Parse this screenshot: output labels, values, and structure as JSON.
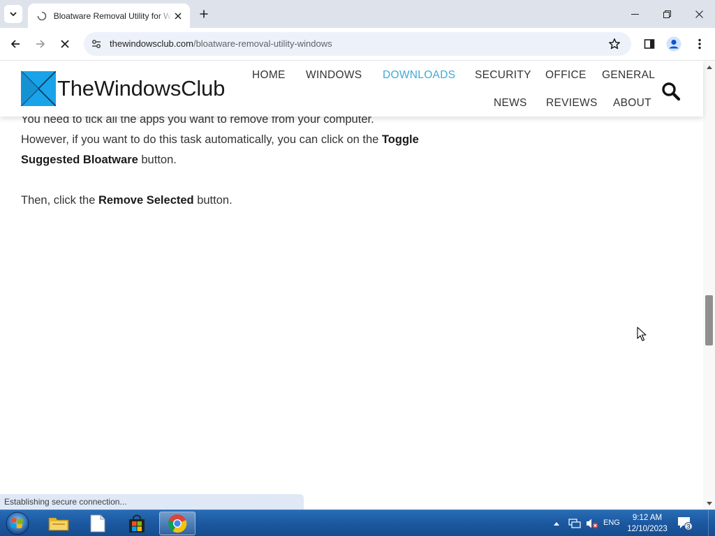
{
  "browser": {
    "tab": {
      "title": "Bloatware Removal Utility for Windows"
    },
    "url": {
      "host": "thewindowsclub.com",
      "path": "/bloatware-removal-utility-windows"
    },
    "status_text": "Establishing secure connection..."
  },
  "site": {
    "logo_text": "TheWindowsClub",
    "nav_row1": [
      {
        "label": "HOME",
        "active": false
      },
      {
        "label": "WINDOWS",
        "active": false
      },
      {
        "label": "DOWNLOADS",
        "active": true
      },
      {
        "label": "SECURITY",
        "active": false
      },
      {
        "label": "OFFICE",
        "active": false
      },
      {
        "label": "GENERAL",
        "active": false
      }
    ],
    "nav_row2": [
      {
        "label": "NEWS"
      },
      {
        "label": "REVIEWS"
      },
      {
        "label": "ABOUT"
      }
    ],
    "accent_color": "#3fa9d8"
  },
  "article": {
    "para1_part1": "You need to tick all the apps you want to remove from your computer. However, if you want to do this task automatically, you can click on the ",
    "para1_bold": "Toggle Suggested Bloatware",
    "para1_part2": " button.",
    "para2_part1": "Then, click the ",
    "para2_bold": "Remove Selected",
    "para2_part2": " button."
  },
  "taskbar": {
    "language": "ENG",
    "time": "9:12 AM",
    "date": "12/10/2023",
    "notification_count": "3"
  }
}
